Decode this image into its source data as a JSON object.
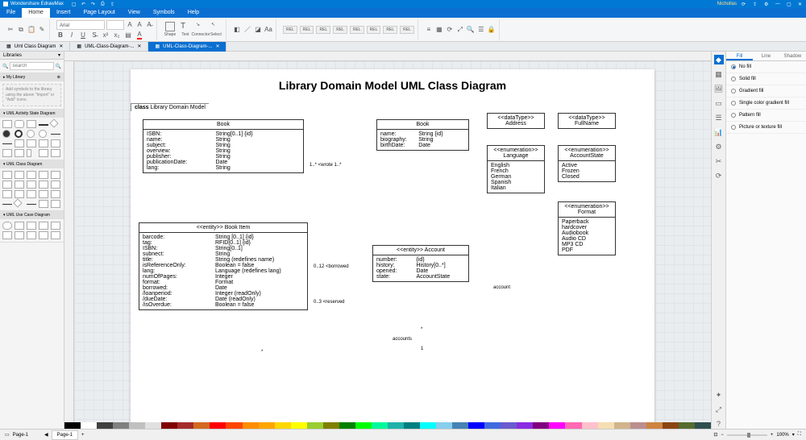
{
  "app": {
    "title": "Wondershare EdrawMax",
    "account": "Nichollas"
  },
  "menu": [
    "File",
    "Home",
    "Insert",
    "Page Layout",
    "View",
    "Symbols",
    "Help"
  ],
  "menu_active": 1,
  "ribbon": {
    "font_name": "Arial",
    "tools": {
      "shape": "Shape",
      "text": "Text",
      "connector": "Connector",
      "select": "Select"
    }
  },
  "doc_tabs": [
    {
      "label": "Uml Class Diagram",
      "active": false
    },
    {
      "label": "UML-Class-Diagram-...",
      "active": false
    },
    {
      "label": "UML-Class-Diagram-...",
      "active": true
    }
  ],
  "left": {
    "header": "Libraries",
    "search_ph": "search",
    "my_library": "My Library",
    "hint": "Add symbols to the library using the above \"Import\" or \"Add\" icons.",
    "sections": [
      "UML Activity State Diagram",
      "UML Class Diagram",
      "UML Use Case Diagram"
    ]
  },
  "right_tabs": [
    "Fill",
    "Line",
    "Shadow"
  ],
  "right_tabs_active": 0,
  "fill_options": [
    "No fill",
    "Solid fill",
    "Gradient fill",
    "Single color gradient fill",
    "Pattern fill",
    "Picture or texture fill"
  ],
  "fill_selected": 0,
  "diagram": {
    "title": "Library Domain Model UML Class Diagram",
    "frame_label": "class Library Domain Model",
    "book": {
      "name": "Book",
      "attrs": [
        [
          "ISBN:",
          "String[0..1] {id}"
        ],
        [
          "name:",
          "String"
        ],
        [
          "subject:",
          "String"
        ],
        [
          "overview:",
          "String"
        ],
        [
          "publisher:",
          "String"
        ],
        [
          "publicationDate:",
          "Date"
        ],
        [
          "lang:",
          "String"
        ]
      ]
    },
    "author": {
      "name": "Book",
      "attrs": [
        [
          "name:",
          "String {id}"
        ],
        [
          "biography:",
          "String"
        ],
        [
          "birthDate:",
          "Date"
        ]
      ]
    },
    "rel_book_author": "1..* <wrote 1..*",
    "book_item": {
      "name": "<<entity>> Book Item",
      "attrs": [
        [
          "barcode:",
          "String [0..1] {id}"
        ],
        [
          "tag:",
          "RFID[0..1] {id}"
        ],
        [
          "ISBN:",
          "String[0..1]"
        ],
        [
          "subnect:",
          "String"
        ],
        [
          "title:",
          "String (redefines name)"
        ],
        [
          "isReferenceOnly:",
          "Boolean = false"
        ],
        [
          "lang:",
          "Language (redefines lang)"
        ],
        [
          "numOfPages:",
          "Integer"
        ],
        [
          "format:",
          "Format"
        ],
        [
          "borrowed:",
          "Date"
        ],
        [
          "/loanperiod:",
          "Integer (readOnly)"
        ],
        [
          "/dueDate:",
          "Date (readOnly)"
        ],
        [
          "/isOverdue:",
          "Boolean = false"
        ]
      ]
    },
    "rel_borrowed": "0..12 <borrowed",
    "rel_reserved": "0..3 <reserved",
    "account": {
      "name": "<<entity>> Account",
      "attrs": [
        [
          "number:",
          "{id}"
        ],
        [
          "history:",
          "History[0..*]"
        ],
        [
          "opened:",
          "Date"
        ],
        [
          "state:",
          "AccountState"
        ]
      ]
    },
    "rel_account": "account",
    "rel_accounts": "accounts",
    "mult_star": "*",
    "mult_one": "1",
    "address": {
      "stereo": "<<dataType>>",
      "name": "Address"
    },
    "fullname": {
      "stereo": "<<dataType>>",
      "name": "FullName"
    },
    "language": {
      "stereo": "<<enumeration>>",
      "name": "Language",
      "vals": [
        "English",
        "French",
        "German",
        "Spanish",
        "Italian"
      ]
    },
    "account_state": {
      "stereo": "<<enumeration>>",
      "name": "AccountState",
      "vals": [
        "Active",
        "Frozen",
        "Closed"
      ]
    },
    "format": {
      "stereo": "<<enumeration>>",
      "name": "Format",
      "vals": [
        "Paperback",
        "hardcover",
        "Audiobook",
        "Audio CD",
        "MP3 CD",
        "PDF"
      ]
    }
  },
  "palette": [
    "#000",
    "#fff",
    "#404040",
    "#808080",
    "#c0c0c0",
    "#e0e0e0",
    "#800000",
    "#a52a2a",
    "#d2691e",
    "#ff0000",
    "#ff4500",
    "#ff8c00",
    "#ffa500",
    "#ffd700",
    "#ffff00",
    "#9acd32",
    "#808000",
    "#008000",
    "#00ff00",
    "#00fa9a",
    "#20b2aa",
    "#008080",
    "#00ffff",
    "#87ceeb",
    "#4682b4",
    "#0000ff",
    "#4169e1",
    "#6a5acd",
    "#8a2be2",
    "#800080",
    "#ff00ff",
    "#ff69b4",
    "#ffc0cb",
    "#f5deb3",
    "#d2b48c",
    "#bc8f8f",
    "#cd853f",
    "#8b4513",
    "#556b2f",
    "#2f4f4f"
  ],
  "status": {
    "page_label": "Page-1",
    "zoom": "100%"
  }
}
